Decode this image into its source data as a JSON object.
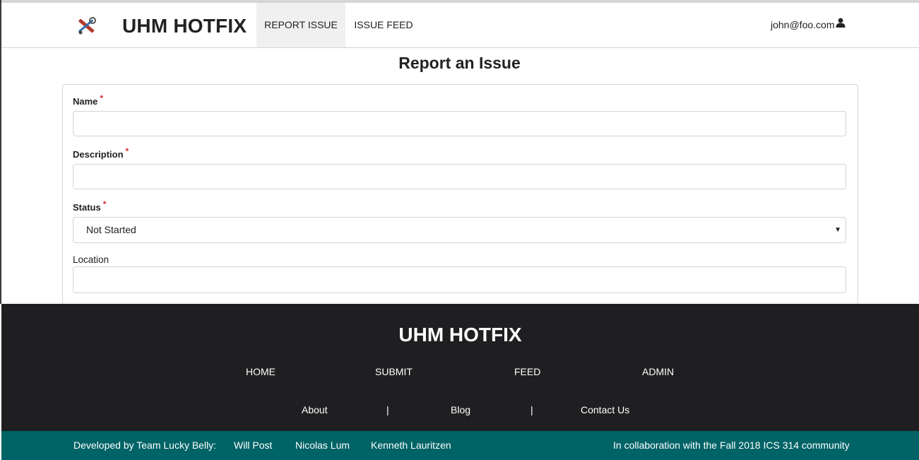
{
  "navbar": {
    "brand": "UHM HOTFIX",
    "items": [
      {
        "label": "REPORT ISSUE",
        "active": true
      },
      {
        "label": "ISSUE FEED",
        "active": false
      }
    ],
    "user": "john@foo.com"
  },
  "page": {
    "title": "Report an Issue"
  },
  "form": {
    "name_label": "Name",
    "name_value": "",
    "description_label": "Description",
    "description_value": "",
    "status_label": "Status",
    "status_value": "Not Started",
    "location_label": "Location",
    "location_value": "",
    "required_marker": "*"
  },
  "footer": {
    "brand": "UHM HOTFIX",
    "nav": [
      "HOME",
      "SUBMIT",
      "FEED",
      "ADMIN"
    ],
    "links": [
      "About",
      "Blog",
      "Contact Us"
    ],
    "separator": "|"
  },
  "bottom_bar": {
    "developed_by": "Developed by Team Lucky Belly:",
    "members": [
      "Will Post",
      "Nicolas Lum",
      "Kenneth Lauritzen"
    ],
    "collaboration": "In collaboration with the Fall 2018 ICS 314 community"
  },
  "colors": {
    "footer_bg": "#1f1f21",
    "bottom_bar_bg": "#006366",
    "required": "#db2828",
    "active_nav_bg": "#f0f0f0"
  }
}
